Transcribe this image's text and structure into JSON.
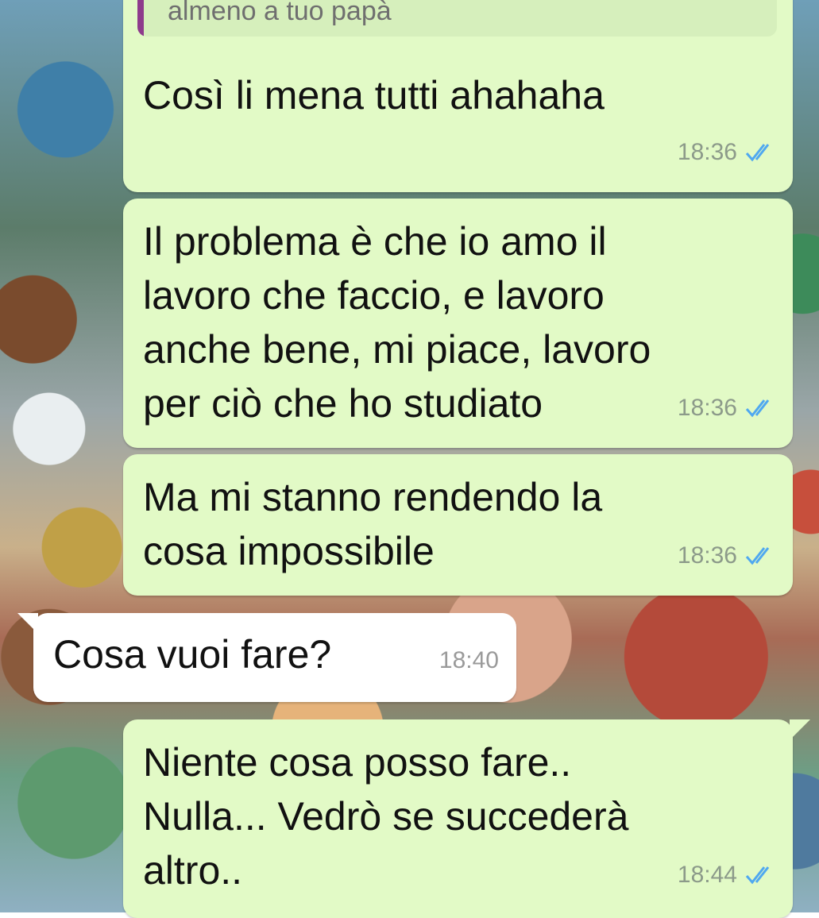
{
  "quoted": {
    "text": "almeno a tuo papà"
  },
  "messages": [
    {
      "text": "Così li mena tutti ahahaha",
      "time": "18:36"
    },
    {
      "text": "Il problema è che io amo il\nlavoro che faccio, e lavoro\nanche bene, mi piace, lavoro\nper ciò che ho studiato",
      "time": "18:36"
    },
    {
      "text": "Ma mi stanno rendendo la\ncosa impossibile",
      "time": "18:36"
    },
    {
      "text": "Cosa vuoi fare?",
      "time": "18:40"
    },
    {
      "text": "Niente cosa posso fare..\nNulla... Vedrò se succederà\naltro..",
      "time": "18:44"
    }
  ],
  "icons": {
    "read_receipt": "double-check-icon"
  },
  "colors": {
    "outgoing_bubble": "#e2fac6",
    "incoming_bubble": "#ffffff",
    "read_check": "#4fa8f0",
    "quote_bar": "#8e3b8c"
  }
}
